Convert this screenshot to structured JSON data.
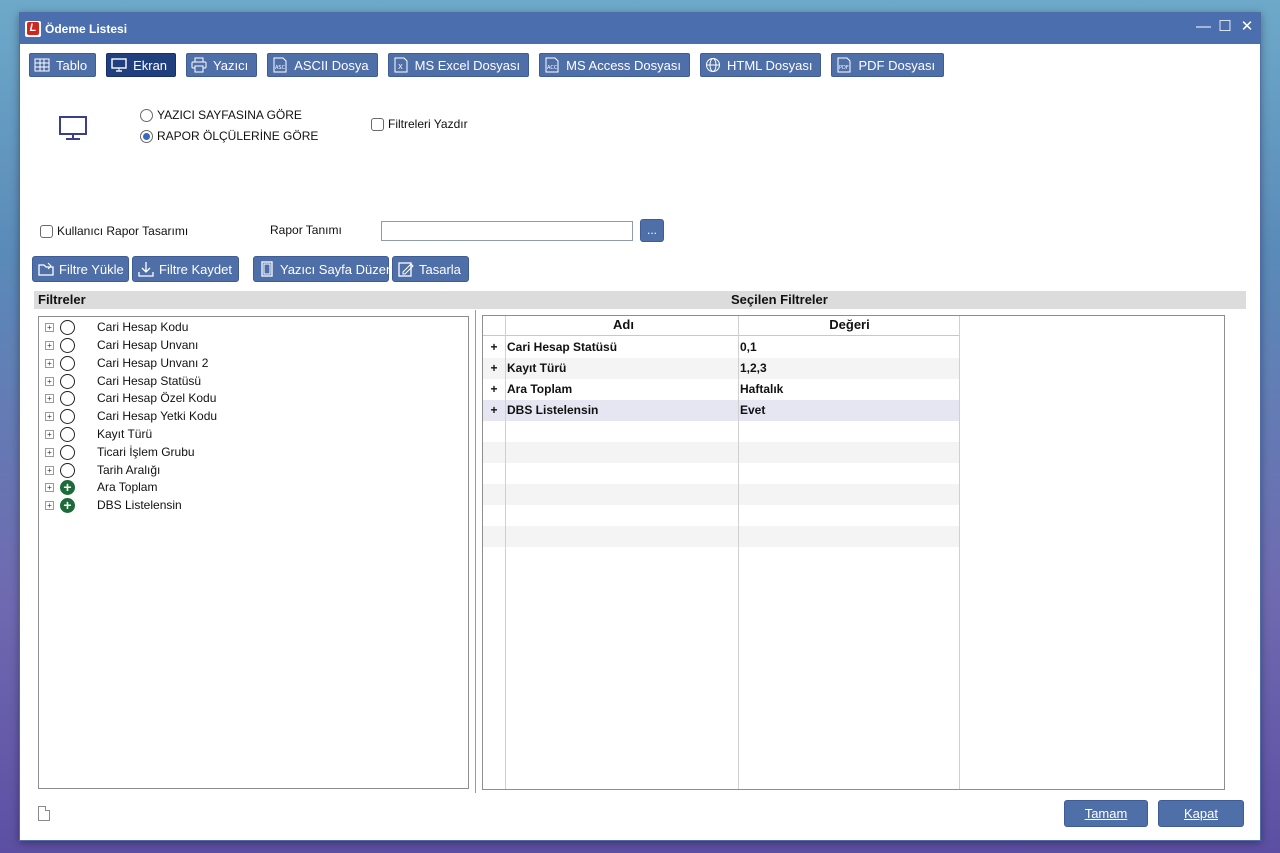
{
  "window": {
    "title": "Ödeme Listesi",
    "controls": {
      "minimize": "—",
      "maximize": "☐",
      "close": "✕"
    }
  },
  "tabs": [
    {
      "label": "Tablo",
      "icon": "table-icon",
      "active": false
    },
    {
      "label": "Ekran",
      "icon": "monitor-icon",
      "active": true
    },
    {
      "label": "Yazıcı",
      "icon": "printer-icon",
      "active": false
    },
    {
      "label": "ASCII Dosya",
      "icon": "ascii-file-icon",
      "active": false
    },
    {
      "label": "MS Excel Dosyası",
      "icon": "excel-file-icon",
      "active": false
    },
    {
      "label": "MS Access Dosyası",
      "icon": "access-file-icon",
      "active": false
    },
    {
      "label": "HTML Dosyası",
      "icon": "globe-icon",
      "active": false
    },
    {
      "label": "PDF Dosyası",
      "icon": "pdf-file-icon",
      "active": false
    }
  ],
  "options": {
    "radio_printer_page": "YAZICI SAYFASINA GÖRE",
    "radio_report_size": "RAPOR ÖLÇÜLERİNE GÖRE",
    "selected_radio": "radio_report_size",
    "print_filters": "Filtreleri Yazdır",
    "user_report_design": "Kullanıcı Rapor Tasarımı",
    "report_definition_label": "Rapor Tanımı",
    "report_definition_value": "",
    "ellipsis": "..."
  },
  "actions": {
    "load_filter": "Filtre Yükle",
    "save_filter": "Filtre Kaydet",
    "printer_page_layout": "Yazıcı Sayfa Düzeni",
    "design": "Tasarla"
  },
  "filters_header": "Filtreler",
  "selected_filters_header": "Seçilen Filtreler",
  "filters": [
    {
      "label": "Cari Hesap Kodu",
      "status": "empty"
    },
    {
      "label": "Cari Hesap Unvanı",
      "status": "empty"
    },
    {
      "label": "Cari Hesap Unvanı 2",
      "status": "empty"
    },
    {
      "label": "Cari Hesap Statüsü",
      "status": "empty"
    },
    {
      "label": "Cari Hesap Özel Kodu",
      "status": "empty"
    },
    {
      "label": "Cari Hesap Yetki Kodu",
      "status": "empty"
    },
    {
      "label": "Kayıt Türü",
      "status": "empty"
    },
    {
      "label": "Ticari İşlem Grubu",
      "status": "empty"
    },
    {
      "label": "Tarih Aralığı",
      "status": "empty"
    },
    {
      "label": "Ara Toplam",
      "status": "set"
    },
    {
      "label": "DBS Listelensin",
      "status": "set"
    }
  ],
  "grid": {
    "columns": [
      "Adı",
      "Değeri"
    ],
    "rows": [
      {
        "marker": "+",
        "name": "Cari Hesap Statüsü",
        "value": "0,1"
      },
      {
        "marker": "+",
        "name": "Kayıt Türü",
        "value": "1,2,3"
      },
      {
        "marker": "+",
        "name": "Ara Toplam",
        "value": "Haftalık"
      },
      {
        "marker": "+",
        "name": "DBS Listelensin",
        "value": "Evet"
      }
    ]
  },
  "footer": {
    "ok": "Tamam",
    "close": "Kapat"
  },
  "colors": {
    "titlebar": "#4b6fae",
    "button": "#4f6fa9",
    "active_tab": "#1f3f7e",
    "selected_row": "#e6e6f2",
    "alt_row": "#f4f4f4",
    "set_status": "#1e6b3a"
  }
}
